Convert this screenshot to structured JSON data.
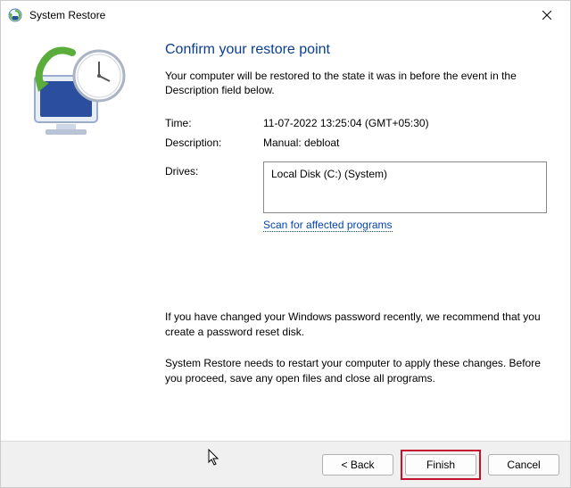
{
  "window": {
    "title": "System Restore"
  },
  "main": {
    "heading": "Confirm your restore point",
    "subtext": "Your computer will be restored to the state it was in before the event in the Description field below.",
    "time_label": "Time:",
    "time_value": "11-07-2022 13:25:04 (GMT+05:30)",
    "description_label": "Description:",
    "description_value": "Manual: debloat",
    "drives_label": "Drives:",
    "drives_value": "Local Disk (C:) (System)",
    "scan_link": "Scan for affected programs",
    "note1": "If you have changed your Windows password recently, we recommend that you create a password reset disk.",
    "note2": "System Restore needs to restart your computer to apply these changes. Before you proceed, save any open files and close all programs."
  },
  "footer": {
    "back": "< Back",
    "finish": "Finish",
    "cancel": "Cancel"
  }
}
